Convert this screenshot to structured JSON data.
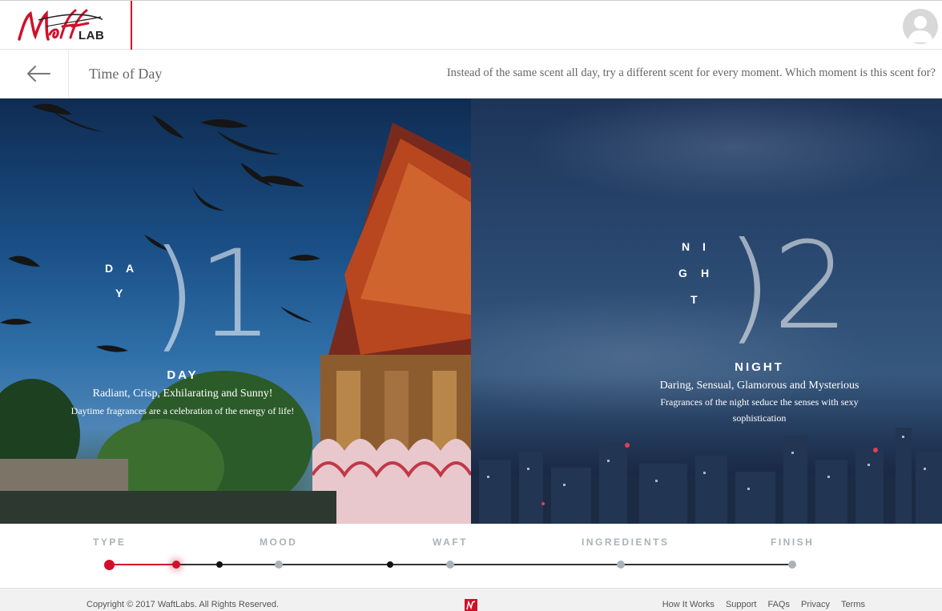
{
  "header": {
    "logo_text": "Waft",
    "logo_lab": "LAB"
  },
  "subheader": {
    "title": "Time of Day",
    "instruction": "Instead of the same scent all day, try a different scent for every moment. Which moment is this scent for?"
  },
  "options": [
    {
      "vertical_letters": [
        "D",
        "A",
        "Y"
      ],
      "number": ")1",
      "title": "DAY",
      "subtitle": "Radiant, Crisp, Exhilarating and Sunny!",
      "description": "Daytime fragrances are a celebration of the energy of life!"
    },
    {
      "vertical_letters": [
        "N",
        "I",
        "G",
        "H",
        "T"
      ],
      "number": ")2",
      "title": "NIGHT",
      "subtitle": "Daring, Sensual, Glamorous and Mysterious",
      "description_lines": [
        "Fragrances of the night seduce the senses with sexy",
        "sophistication"
      ]
    }
  ],
  "steps": {
    "labels": [
      "TYPE",
      "MOOD",
      "WAFT",
      "INGREDIENTS",
      "FINISH"
    ],
    "current_step": "TYPE",
    "colors": {
      "active": "#d0102b",
      "inactive": "#aab2b8",
      "track": "#333333"
    }
  },
  "footer": {
    "copyright": "Copyright © 2017 WaftLabs. All Rights Reserved.",
    "links": [
      "How It Works",
      "Support",
      "FAQs",
      "Privacy",
      "Terms"
    ]
  },
  "icons": {
    "back": "arrow-left-icon",
    "avatar": "user-avatar-icon"
  },
  "colors": {
    "brand": "#d0102b"
  }
}
